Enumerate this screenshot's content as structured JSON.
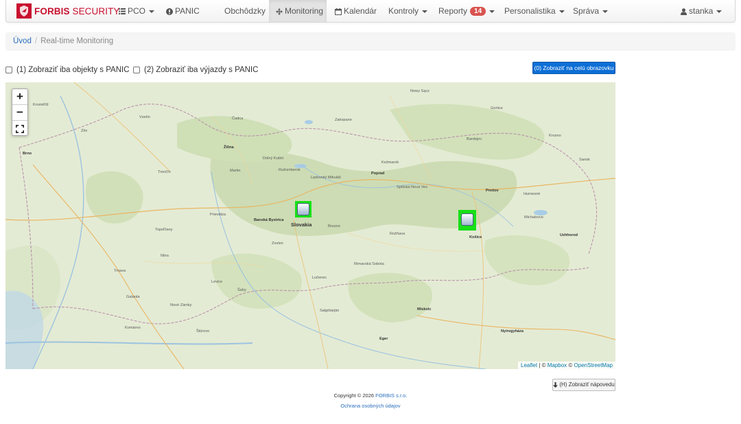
{
  "app": {
    "brand_bold": "FORBIS",
    "brand_light": " SECURITY",
    "accent": "#c8102e"
  },
  "navbar": {
    "pco": "PCO",
    "panic": "PANIC",
    "obchodzky": "Obchôdzky",
    "monitoring": "Monitoring",
    "kalendar": "Kalendár",
    "kontroly": "Kontroly",
    "reporty": "Reporty",
    "reporty_badge": "14",
    "personalistika": "Personalistika",
    "sprava": "Správa",
    "user": "stanka"
  },
  "breadcrumb": {
    "home": "Úvod",
    "current": "Real-time Monitoring"
  },
  "filters": {
    "panic_objects": "(1) Zobraziť iba objekty s PANIC",
    "panic_trips": "(2) Zobraziť iba výjazdy s PANIC",
    "fullscreen": "(0) Zobraziť na celú obrazovku"
  },
  "map": {
    "zoom_in": "+",
    "zoom_out": "−",
    "attribution_leaflet": "Leaflet",
    "attribution_sep": " | © ",
    "attribution_mapbox": "Mapbox",
    "attribution_osm": "OpenStreetMap",
    "labels": {
      "slovakia": "Slovakia",
      "banska_bystrica": "Banská Bystrica",
      "brno": "Brno",
      "zilina": "Žilina",
      "poprad": "Poprad",
      "kosice": "Košice",
      "presov": "Prešov",
      "miskolc": "Miskolc",
      "nyiregyhaza": "Nyíregyháza",
      "uzhhorod": "Uzhhorod",
      "eger": "Eger",
      "trnava": "Trnava",
      "nitra": "Nitra",
      "trencin": "Trenčín",
      "zakopane": "Zakopane",
      "nowy_sacz": "Nowy Sącz",
      "lucenec": "Lučenec",
      "rimavska_sobota": "Rimavská Sobota",
      "martin": "Martin",
      "ruzomberok": "Ružomberok",
      "liptovsky_mikulas": "Liptovský Mikuláš",
      "spisska_nova_ves": "Spišská Nová Ves",
      "michalovce": "Michalovce",
      "humenne": "Humenné",
      "bardejov": "Bardejov",
      "kezmarok": "Kežmarok",
      "prievidza": "Prievidza",
      "zvolen": "Zvolen",
      "rozsnava": "Rožňava",
      "salgotarjan": "Salgótarján",
      "komarno": "Komárno",
      "levice": "Levice",
      "kromeriz": "Kroměříž",
      "zlin": "Zlín",
      "vsetin": "Vsetín",
      "cadca": "Čadca",
      "nove_zamky": "Nové Zámky",
      "topolcany": "Topoľčany",
      "dolny_kubin": "Dolný Kubín",
      "brezno": "Brezno",
      "krosno": "Krosno",
      "sanok": "Sanok",
      "gorlice": "Gorlice",
      "sahy": "Šahy",
      "sturovo": "Štúrovo",
      "galanta": "Galanta"
    }
  },
  "help": {
    "button": "(H) Zobraziť nápovedu"
  },
  "footer": {
    "copyright_prefix": "Copyright © 2026 ",
    "company": "FORBIS s.r.o.",
    "privacy": "Ochrana osobných údajov"
  }
}
